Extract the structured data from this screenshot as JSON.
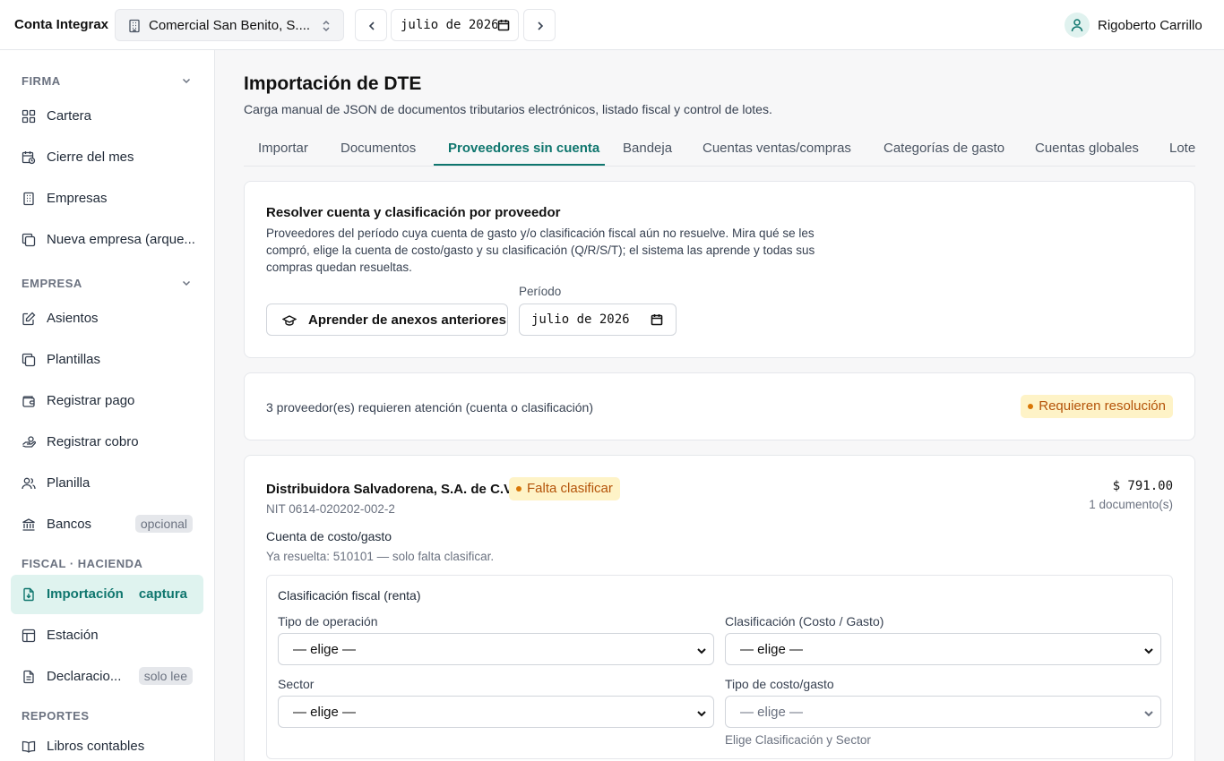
{
  "topbar": {
    "brand": "Conta Integrax",
    "company": "Comercial San Benito, S....",
    "period": "julio de 2026",
    "user": "Rigoberto Carrillo"
  },
  "sidebar": {
    "sections": [
      {
        "title": "FIRMA"
      },
      {
        "title": "EMPRESA"
      },
      {
        "title": "FISCAL · HACIENDA"
      },
      {
        "title": "REPORTES"
      }
    ],
    "items": [
      {
        "label": "Cartera"
      },
      {
        "label": "Cierre del mes"
      },
      {
        "label": "Empresas"
      },
      {
        "label": "Nueva empresa (arque..."
      },
      {
        "label": "Asientos"
      },
      {
        "label": "Plantillas"
      },
      {
        "label": "Registrar pago"
      },
      {
        "label": "Registrar cobro"
      },
      {
        "label": "Planilla"
      },
      {
        "label": "Bancos",
        "badge": "opcional"
      },
      {
        "label": "Importación",
        "tag": "captura",
        "active": true
      },
      {
        "label": "Estación"
      },
      {
        "label": "Declaracio...",
        "badge": "solo lee"
      },
      {
        "label": "Libros contables"
      }
    ]
  },
  "main": {
    "title": "Importación de DTE",
    "subtitle": "Carga manual de JSON de documentos tributarios electrónicos, listado fiscal y control de lotes.",
    "tabs": [
      {
        "label": "Importar"
      },
      {
        "label": "Documentos"
      },
      {
        "label": "Proveedores sin cuenta",
        "active": true
      },
      {
        "label": "Bandeja"
      },
      {
        "label": "Cuentas ventas/compras"
      },
      {
        "label": "Categorías de gasto"
      },
      {
        "label": "Cuentas globales"
      },
      {
        "label": "Lote"
      }
    ]
  },
  "resolver": {
    "title": "Resolver cuenta y clasificación por proveedor",
    "description": "Proveedores del período cuya cuenta de gasto y/o clasificación fiscal aún no resuelve. Mira qué se les compró, elige la cuenta de costo/gasto y su clasificación (Q/R/S/T); el sistema las aprende y todas sus compras quedan resueltas.",
    "learn_button": "Aprender de anexos anteriores",
    "period_label": "Período",
    "period_value": "julio de 2026"
  },
  "summary": {
    "text": "3 proveedor(es) requieren atención (cuenta o clasificación)",
    "badge": "Requieren resolución"
  },
  "supplier": {
    "name": "Distribuidora Salvadorena, S.A. de C.V.",
    "status": "Falta clasificar",
    "nit": "NIT 0614-020202-002-2",
    "amount": "$ 791.00",
    "doc_count": "1 documento(s)",
    "account_label": "Cuenta de costo/gasto",
    "account_resolved": "Ya resuelta: 510101 — solo falta clasificar.",
    "classification": {
      "title": "Clasificación fiscal (renta)",
      "fields": [
        {
          "label": "Tipo de operación",
          "value": "— elige —"
        },
        {
          "label": "Clasificación (Costo / Gasto)",
          "value": "— elige —"
        },
        {
          "label": "Sector",
          "value": "— elige —"
        },
        {
          "label": "Tipo de costo/gasto",
          "value": "— elige —",
          "disabled": true,
          "hint": "Elige Clasificación y Sector"
        }
      ]
    }
  },
  "colors": {
    "accent": "#0f766e",
    "accent_bg": "#dff3ef",
    "warning": "#b45309",
    "warning_bg": "#fef3c7"
  }
}
